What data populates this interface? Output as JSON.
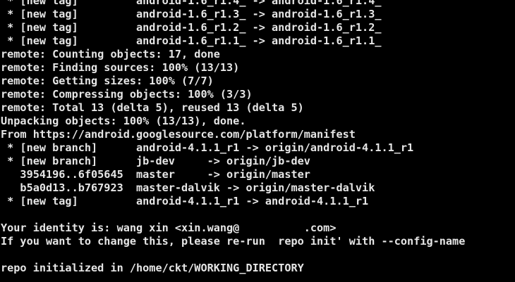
{
  "terminal": {
    "background": "#000000",
    "foreground": "#e6e6e6",
    "lines": [
      " * [new tag]         android-1.6_r1.4_ -> android-1.6_r1.4_",
      " * [new tag]         android-1.6_r1.3_ -> android-1.6_r1.3_",
      " * [new tag]         android-1.6_r1.2_ -> android-1.6_r1.2_",
      " * [new tag]         android-1.6_r1.1_ -> android-1.6_r1.1_",
      "remote: Counting objects: 17, done",
      "remote: Finding sources: 100% (13/13)",
      "remote: Getting sizes: 100% (7/7)",
      "remote: Compressing objects: 100% (3/3)",
      "remote: Total 13 (delta 5), reused 13 (delta 5)",
      "Unpacking objects: 100% (13/13), done.",
      "From https://android.googlesource.com/platform/manifest",
      " * [new branch]      android-4.1.1_r1 -> origin/android-4.1.1_r1",
      " * [new branch]      jb-dev     -> origin/jb-dev",
      "   3954196..6f05645  master     -> origin/master",
      "   b5a0d13..b767923  master-dalvik -> origin/master-dalvik",
      " * [new tag]         android-4.1.1_r1 -> android-4.1.1_r1",
      "",
      "Your identity is: wang xin <xin.wang@          .com>",
      "If you want to change this, please re-run  repo init' with --config-name",
      "",
      "repo initialized in /home/ckt/WORKING_DIRECTORY"
    ]
  }
}
